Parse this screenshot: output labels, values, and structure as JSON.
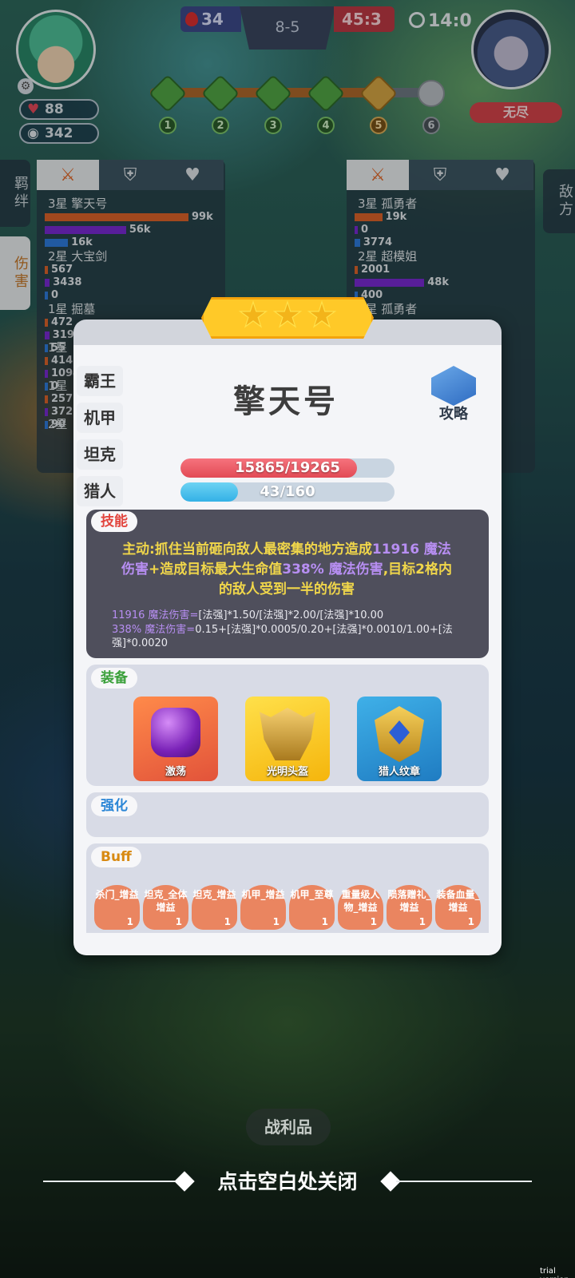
{
  "hud": {
    "left_score": "34",
    "round": "8-5",
    "right_score": "45:3",
    "timer": "14:0",
    "hp": "88",
    "coins": "342",
    "enemy_mode": "无尽",
    "stages": [
      "1",
      "2",
      "3",
      "4",
      "5",
      "6"
    ],
    "current_stage_index": 4
  },
  "damage_panel": {
    "side_tabs": [
      "羁绊",
      "伤害"
    ],
    "enemy_tab": "敌方",
    "left_rows": [
      {
        "name": "3星 擎天号",
        "values": [
          "99k",
          "56k",
          "16k"
        ]
      },
      {
        "name": "2星 大宝剑",
        "values": [
          "567",
          "3438",
          "0"
        ]
      },
      {
        "name": "1星 掘墓",
        "values": [
          "472",
          "3193",
          "55"
        ]
      },
      {
        "name": "1星",
        "values": [
          "414",
          "1094",
          "0"
        ]
      },
      {
        "name": "1星",
        "values": [
          "257",
          "372",
          "90"
        ]
      },
      {
        "name": "2星",
        "values": []
      }
    ],
    "right_rows": [
      {
        "name": "3星 孤勇者",
        "values": [
          "19k",
          "0",
          "3774"
        ]
      },
      {
        "name": "2星 超模姐",
        "values": [
          "2001",
          "48k",
          "400"
        ]
      },
      {
        "name": "1星 孤勇者",
        "values": []
      }
    ]
  },
  "card": {
    "stars": 3,
    "hero_name": "擎天号",
    "traits": [
      "霸王",
      "机甲",
      "坦克",
      "猎人"
    ],
    "guide_label": "攻略",
    "hp_text": "15865/19265",
    "hp_fraction": 0.8235,
    "mana_text": "43/160",
    "mana_fraction": 0.27,
    "skill_tag": "技能",
    "skill_line1_a": "主动:抓住当前砸向敌人最密集的地方造成",
    "skill_line1_b": "11916 魔法",
    "skill_line2_a": "伤害",
    "skill_line2_b": "+造成目标最大生命值",
    "skill_line2_c": "338% 魔法伤害",
    "skill_line2_d": ",目标2格内",
    "skill_line3": "的敌人受到一半的伤害",
    "formula1_a": "11916 魔法伤害=",
    "formula1_b": "[法强]*1.50/[法强]*2.00/[法强]*10.00",
    "formula2_a": "338% 魔法伤害=",
    "formula2_b": "0.15+[法强]*0.0005/0.20+[法强]*0.0010/1.00+[法强]*0.0020",
    "equip_tag": "装备",
    "equipment": [
      "激荡",
      "光明头盔",
      "猎人纹章"
    ],
    "enhance_tag": "强化",
    "buff_tag": "Buff",
    "buffs": [
      {
        "name": "杀门_增益",
        "count": "1"
      },
      {
        "name": "坦克_全体增益",
        "count": "1"
      },
      {
        "name": "坦克_增益",
        "count": "1"
      },
      {
        "name": "机甲_增益",
        "count": "1"
      },
      {
        "name": "机甲_至尊",
        "count": "1"
      },
      {
        "name": "重量级人物_增益",
        "count": "1"
      },
      {
        "name": "陨落赠礼_增益",
        "count": "1"
      },
      {
        "name": "装备血量_增益",
        "count": "1"
      }
    ]
  },
  "footer": {
    "loot_label": "战利品",
    "close_hint": "点击空白处关闭",
    "watermark": "trial version"
  },
  "colors": {
    "hp": "#e24a55",
    "mana": "#33b1e6",
    "gold": "#ffc928",
    "skill_gold": "#f0d64a",
    "skill_purple": "#b78ef2",
    "buff": "#ea8560"
  }
}
